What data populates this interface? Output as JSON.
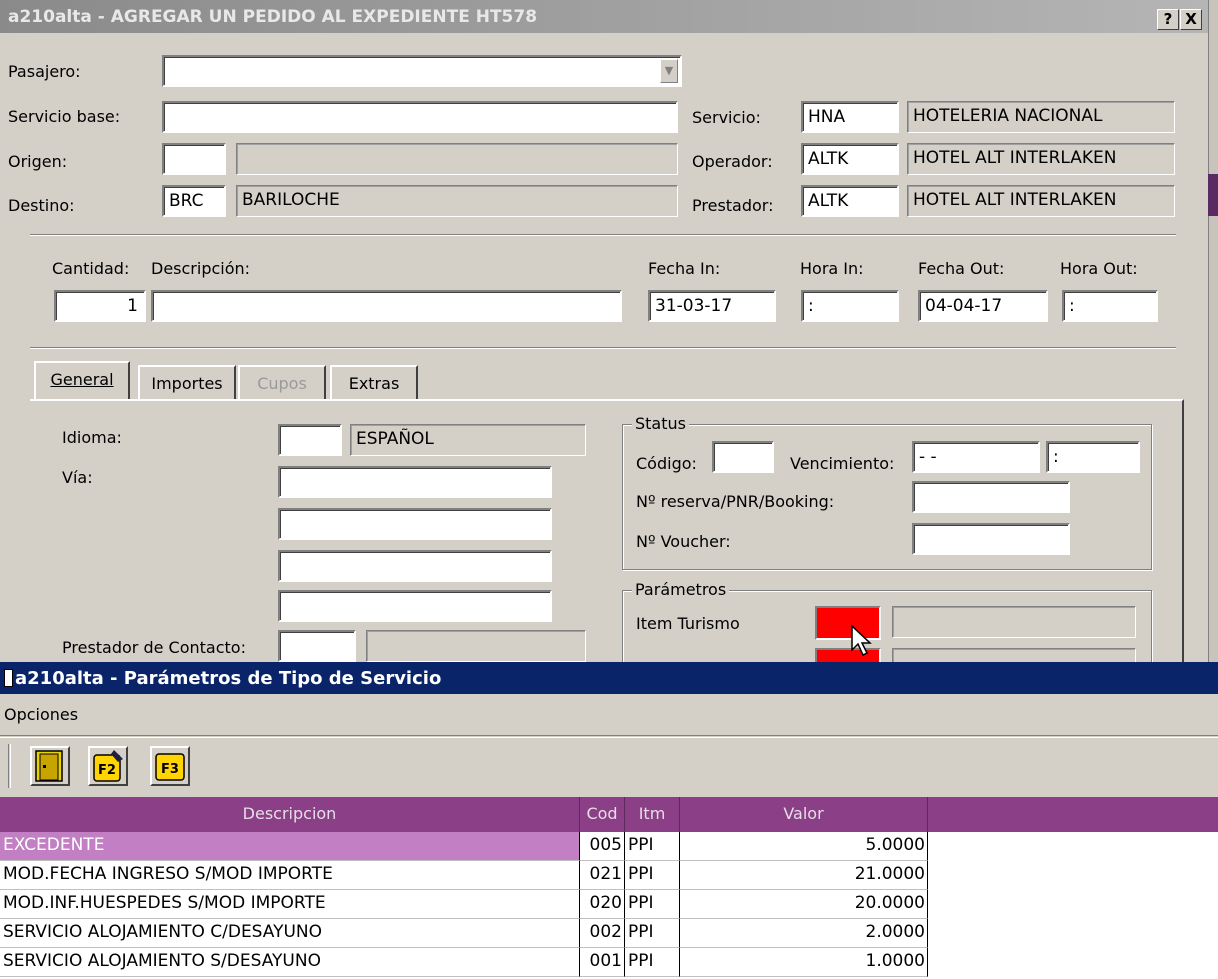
{
  "win1": {
    "title": "a210alta - AGREGAR UN PEDIDO AL EXPEDIENTE HT578",
    "help_btn": "?",
    "close_btn": "X"
  },
  "fields": {
    "pasajero_label": "Pasajero:",
    "pasajero_value": "",
    "servicio_base_label": "Servicio base:",
    "servicio_base_value": "",
    "origen_label": "Origen:",
    "origen_code": "",
    "origen_name": "",
    "destino_label": "Destino:",
    "destino_code": "BRC",
    "destino_name": "BARILOCHE",
    "servicio_label": "Servicio:",
    "servicio_code": "HNA",
    "servicio_name": "HOTELERIA NACIONAL",
    "operador_label": "Operador:",
    "operador_code": "ALTK",
    "operador_name": "HOTEL ALT INTERLAKEN",
    "prestador_label": "Prestador:",
    "prestador_code": "ALTK",
    "prestador_name": "HOTEL ALT INTERLAKEN"
  },
  "line": {
    "cantidad_label": "Cantidad:",
    "cantidad_value": "1",
    "descripcion_label": "Descripción:",
    "descripcion_value": "",
    "fecha_in_label": "Fecha In:",
    "fecha_in_value": "31-03-17",
    "hora_in_label": "Hora In:",
    "hora_in_value": ":",
    "fecha_out_label": "Fecha Out:",
    "fecha_out_value": "04-04-17",
    "hora_out_label": "Hora Out:",
    "hora_out_value": ":"
  },
  "tabs": [
    {
      "label": "General",
      "active": true
    },
    {
      "label": "Importes",
      "active": false
    },
    {
      "label": "Cupos",
      "active": false,
      "disabled": true
    },
    {
      "label": "Extras",
      "active": false
    }
  ],
  "general": {
    "idioma_label": "Idioma:",
    "idioma_code": "",
    "idioma_name": "ESPAÑOL",
    "via_label": "Vía:",
    "prestador_contacto_label": "Prestador de Contacto:"
  },
  "status": {
    "title": "Status",
    "codigo_label": "Código:",
    "codigo_value": "",
    "vencimiento_label": "Vencimiento:",
    "vencimiento_date": "- -",
    "vencimiento_time": ":",
    "reserva_label": "Nº reserva/PNR/Booking:",
    "reserva_value": "",
    "voucher_label": "Nº Voucher:",
    "voucher_value": ""
  },
  "parametros": {
    "title": "Parámetros",
    "item_turismo_label": "Item Turismo",
    "item_turismo_color": "#ff0000"
  },
  "win2": {
    "title": "a210alta - Parámetros de Tipo de Servicio",
    "menu_opciones": "Opciones",
    "tools": [
      "door-exit-icon",
      "f2-edit-icon",
      "f3-icon"
    ]
  },
  "grid": {
    "headers": [
      "Descripcion",
      "Cod",
      "Itm",
      "Valor"
    ],
    "rows": [
      {
        "descripcion": "EXCEDENTE",
        "cod": "005",
        "itm": "PPI",
        "valor": "5.0000",
        "selected": true
      },
      {
        "descripcion": "MOD.FECHA INGRESO S/MOD IMPORTE",
        "cod": "021",
        "itm": "PPI",
        "valor": "21.0000"
      },
      {
        "descripcion": "MOD.INF.HUESPEDES S/MOD IMPORTE",
        "cod": "020",
        "itm": "PPI",
        "valor": "20.0000"
      },
      {
        "descripcion": "SERVICIO ALOJAMIENTO C/DESAYUNO",
        "cod": "002",
        "itm": "PPI",
        "valor": "2.0000"
      },
      {
        "descripcion": "SERVICIO ALOJAMIENTO S/DESAYUNO",
        "cod": "001",
        "itm": "PPI",
        "valor": "1.0000"
      }
    ],
    "header_color": "#8a3f86",
    "selected_color": "#c27fc4"
  }
}
